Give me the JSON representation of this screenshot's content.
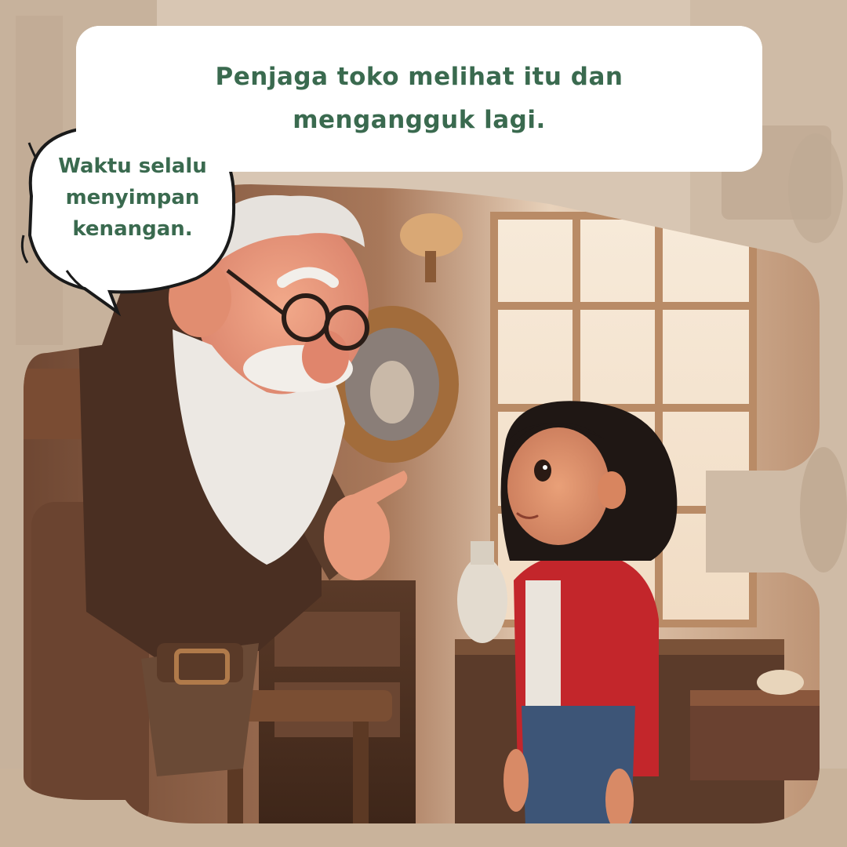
{
  "caption": {
    "line1": "Penjaga toko melihat itu dan",
    "line2": "mengangguk lagi."
  },
  "speech_bubble": {
    "line1": "Waktu selalu",
    "line2": "menyimpan",
    "line3": "kenangan."
  },
  "colors": {
    "text_green": "#3a6a4f",
    "caption_bg": "#ffffff",
    "girl_hoodie": "#c3262b",
    "washed_bg": "#d6c4b0"
  },
  "illustration": {
    "characters": [
      "old-shopkeeper",
      "young-girl"
    ],
    "setting": "antique-shop"
  }
}
